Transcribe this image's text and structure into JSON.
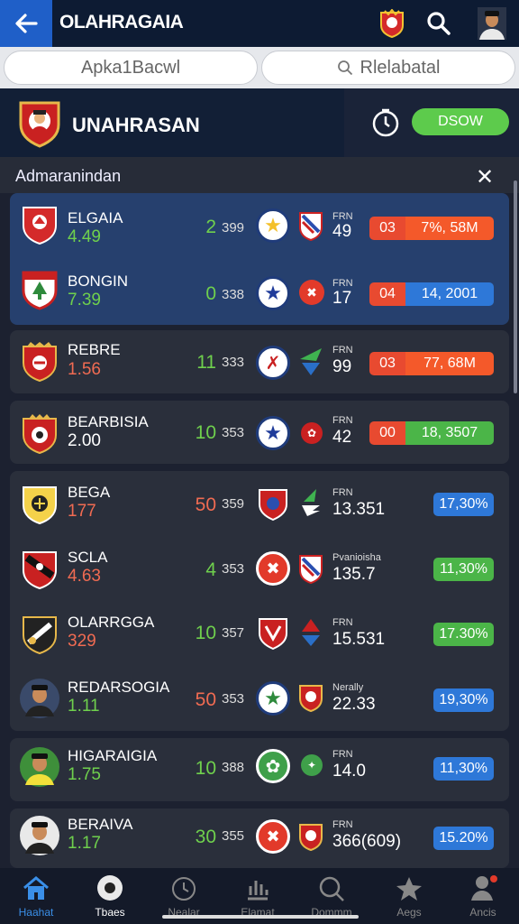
{
  "app": {
    "title": "OLAHRAGAIA"
  },
  "tabs": [
    {
      "label": "Apka1Bacwl"
    },
    {
      "label": "Rlelabatal"
    }
  ],
  "header": {
    "title": "UNAHRASAN",
    "button": "DSOW"
  },
  "section": {
    "title": "Admaranindan"
  },
  "rows": [
    {
      "name": "ELGAIA",
      "value": "4.49",
      "score": "2",
      "sub": "399",
      "r_label": "FRN",
      "r_value": "49",
      "pill_a": "03",
      "pill_b": "7%, 58M"
    },
    {
      "name": "BONGIN",
      "value": "7.39",
      "score": "0",
      "sub": "338",
      "r_label": "FRN",
      "r_value": "17",
      "pill_a": "04",
      "pill_b": "14, 2001"
    },
    {
      "name": "REBRE",
      "value": "1.56",
      "score": "11",
      "sub": "333",
      "r_label": "FRN",
      "r_value": "99",
      "pill_a": "03",
      "pill_b": "77, 68M"
    },
    {
      "name": "BEARBISIA",
      "value": "2.00",
      "score": "10",
      "sub": "353",
      "r_label": "FRN",
      "r_value": "42",
      "pill_a": "00",
      "pill_b": "18, 3507"
    },
    {
      "name": "BEGA",
      "value": "177",
      "score": "50",
      "sub": "359",
      "r_label": "FRN",
      "r_value": "13.351",
      "pct": "17,30%"
    },
    {
      "name": "SCLA",
      "value": "4.63",
      "score": "4",
      "sub": "353",
      "r_label": "Pvanioisha",
      "r_value": "135.7",
      "pct": "11,30%"
    },
    {
      "name": "OLARRGGA",
      "value": "329",
      "score": "10",
      "sub": "357",
      "r_label": "FRN",
      "r_value": "15.531",
      "pct": "17.30%"
    },
    {
      "name": "REDARSOGIA",
      "value": "1.11",
      "score": "50",
      "sub": "353",
      "r_label": "Nerally",
      "r_value": "22.33",
      "pct": "19,30%"
    },
    {
      "name": "HIGARAIGIA",
      "value": "1.75",
      "score": "10",
      "sub": "388",
      "r_label": "FRN",
      "r_value": "14.0",
      "pct": "11,30%"
    },
    {
      "name": "BERAIVA",
      "value": "1.17",
      "score": "30",
      "sub": "355",
      "r_label": "FRN",
      "r_value": "366(609)",
      "pct": "15.20%"
    }
  ],
  "nav": [
    {
      "label": "Haahat",
      "icon": "home-icon"
    },
    {
      "label": "Tbaes",
      "icon": "ball-icon"
    },
    {
      "label": "Nealar",
      "icon": "clock-icon"
    },
    {
      "label": "Elamat",
      "icon": "chart-icon"
    },
    {
      "label": "Dommm",
      "icon": "search-icon"
    },
    {
      "label": "Aegs",
      "icon": "star-icon"
    },
    {
      "label": "Ancis",
      "icon": "profile-icon"
    }
  ],
  "colors": {
    "accent_blue": "#1f5fc8",
    "green": "#5dcb4c",
    "red": "#e84a30",
    "orange": "#f4592a",
    "pct_green": "#4bb548",
    "pct_blue": "#2e78d8"
  }
}
